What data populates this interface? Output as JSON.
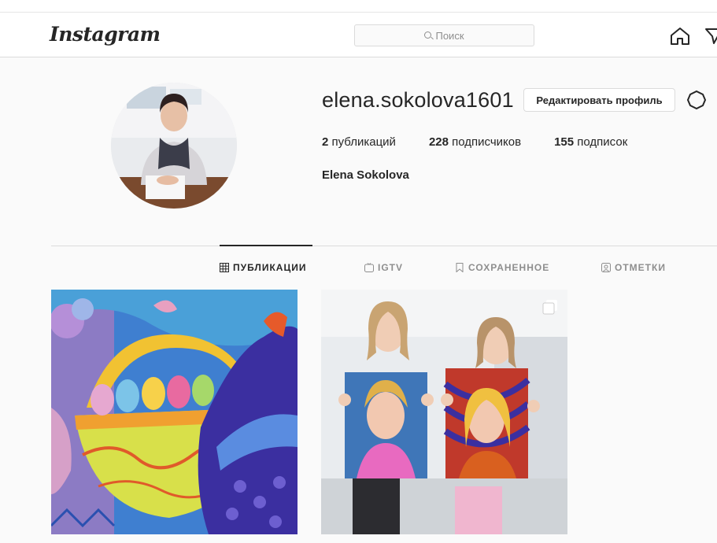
{
  "header": {
    "logo": "Instagram",
    "search_placeholder": "Поиск"
  },
  "profile": {
    "username": "elena.sokolova1601",
    "edit_button": "Редактировать профиль",
    "stats": {
      "posts_count": "2",
      "posts_label": " публикаций",
      "followers_count": "228",
      "followers_label": " подписчиков",
      "following_count": "155",
      "following_label": " подписок"
    },
    "full_name": "Elena Sokolova"
  },
  "tabs": {
    "posts": "ПУБЛИКАЦИИ",
    "igtv": "IGTV",
    "saved": "СОХРАНЕННОЕ",
    "tagged": "ОТМЕТКИ"
  },
  "colors": {
    "text": "#262626",
    "secondary": "#8e8e8e",
    "border": "#dbdbdb",
    "background": "#fafafa"
  },
  "icons": [
    "home-icon",
    "explore-icon",
    "settings-icon",
    "grid-icon",
    "igtv-icon",
    "bookmark-icon",
    "tag-icon",
    "multi-post-icon"
  ]
}
